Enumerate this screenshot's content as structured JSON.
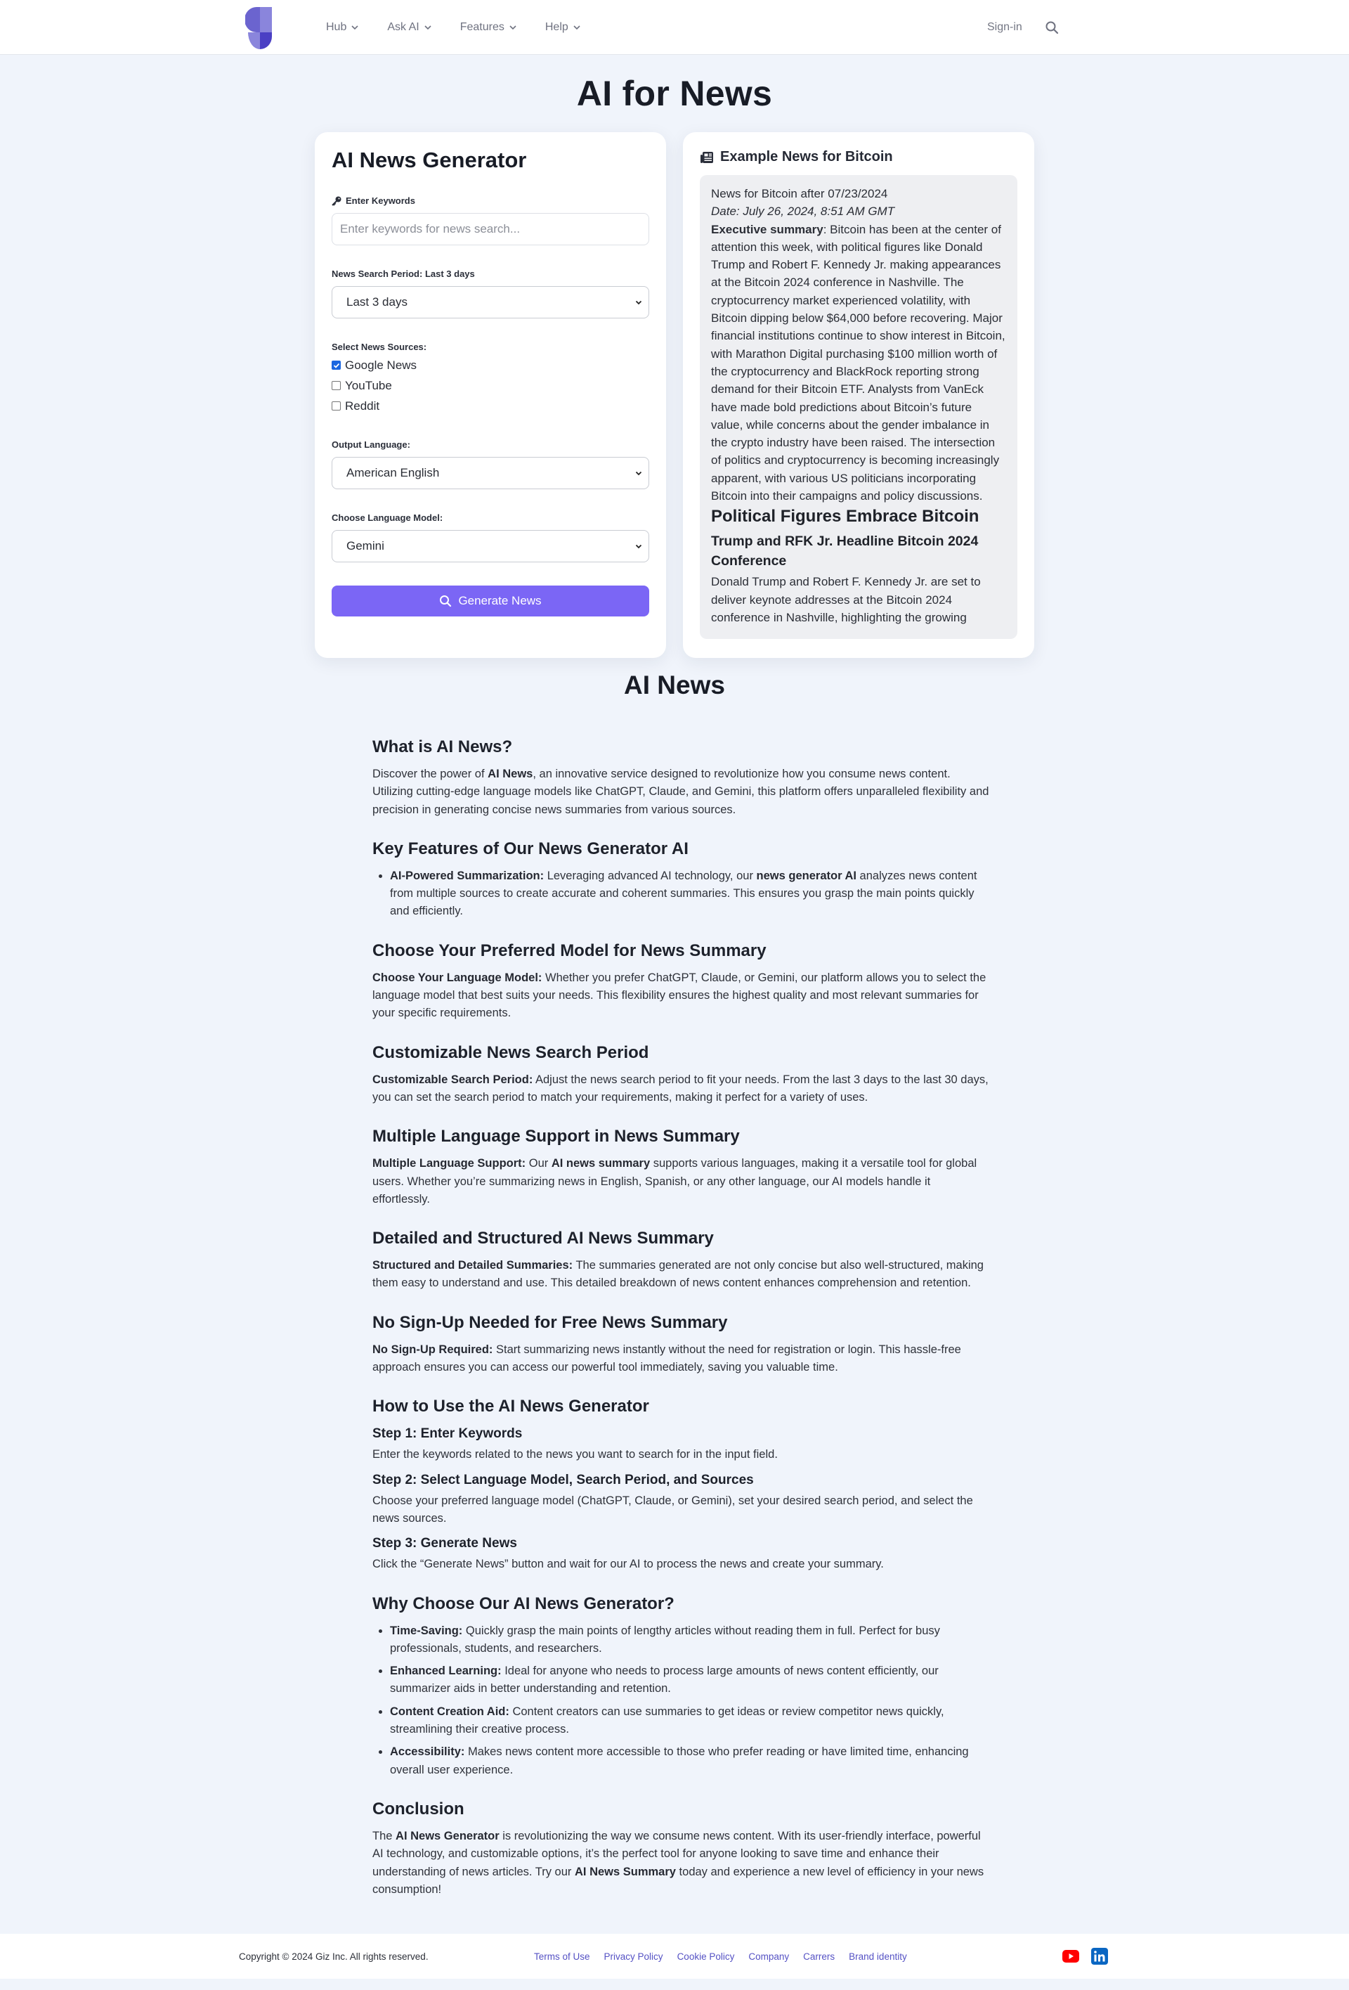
{
  "nav": {
    "logo_label": "Giz",
    "items": [
      {
        "label": "Hub"
      },
      {
        "label": "Ask AI"
      },
      {
        "label": "Features"
      },
      {
        "label": "Help"
      }
    ],
    "signin": "Sign-in",
    "search_icon": "search-icon"
  },
  "page_title": "AI for News",
  "generator": {
    "title": "AI News Generator",
    "keywords_label": "Enter Keywords",
    "keywords_value": "",
    "keywords_placeholder": "Enter keywords for news search...",
    "period_label": "News Search Period: Last 3 days",
    "period_value": "Last 3 days",
    "sources_label": "Select News Sources:",
    "sources": [
      {
        "label": "Google News",
        "checked": true
      },
      {
        "label": "YouTube",
        "checked": false
      },
      {
        "label": "Reddit",
        "checked": false
      }
    ],
    "language_label": "Output Language:",
    "language_value": "American English",
    "model_label": "Choose Language Model:",
    "model_value": "Gemini",
    "generate_label": "Generate News",
    "accent_color": "#7b66f5"
  },
  "example": {
    "title": "Example News for Bitcoin",
    "heading_line": "News for Bitcoin after 07/23/2024",
    "date_line": "Date: July 26, 2024, 8:51 AM GMT",
    "summary_label": "Executive summary",
    "summary_text": ": Bitcoin has been at the center of attention this week, with political figures like Donald Trump and Robert F. Kennedy Jr. making appearances at the Bitcoin 2024 conference in Nashville. The cryptocurrency market experienced volatility, with Bitcoin dipping below $64,000 before recovering. Major financial institutions continue to show interest in Bitcoin, with Marathon Digital purchasing $100 million worth of the cryptocurrency and BlackRock reporting strong demand for their Bitcoin ETF. Analysts from VanEck have made bold predictions about Bitcoin’s future value, while concerns about the gender imbalance in the crypto industry have been raised. The intersection of politics and cryptocurrency is becoming increasingly apparent, with various US politicians incorporating Bitcoin into their campaigns and policy discussions.",
    "section_heading": "Political Figures Embrace Bitcoin",
    "sub_heading": "Trump and RFK Jr. Headline Bitcoin 2024 Conference",
    "body_text": "Donald Trump and Robert F. Kennedy Jr. are set to deliver keynote addresses at the Bitcoin 2024 conference in Nashville, highlighting the growing"
  },
  "article": {
    "title": "AI News",
    "sections": [
      {
        "heading": "What is AI News?",
        "paragraphs": [
          [
            [
              "t",
              "Discover the power of "
            ],
            [
              "b",
              "AI News"
            ],
            [
              "t",
              ", an innovative service designed to revolutionize how you consume news content. Utilizing cutting-edge language models like ChatGPT, Claude, and Gemini, this platform offers unparalleled flexibility and precision in generating concise news summaries from various sources."
            ]
          ]
        ]
      },
      {
        "heading": "Key Features of Our News Generator AI",
        "bullets": [
          [
            [
              "b",
              "AI-Powered Summarization:"
            ],
            [
              "t",
              " Leveraging advanced AI technology, our "
            ],
            [
              "b",
              "news generator AI"
            ],
            [
              "t",
              " analyzes news content from multiple sources to create accurate and coherent summaries. This ensures you grasp the main points quickly and efficiently."
            ]
          ]
        ]
      },
      {
        "heading": "Choose Your Preferred Model for News Summary",
        "paragraphs": [
          [
            [
              "b",
              "Choose Your Language Model:"
            ],
            [
              "t",
              " Whether you prefer ChatGPT, Claude, or Gemini, our platform allows you to select the language model that best suits your needs. This flexibility ensures the highest quality and most relevant summaries for your specific requirements."
            ]
          ]
        ]
      },
      {
        "heading": "Customizable News Search Period",
        "paragraphs": [
          [
            [
              "b",
              "Customizable Search Period:"
            ],
            [
              "t",
              " Adjust the news search period to fit your needs. From the last 3 days to the last 30 days, you can set the search period to match your requirements, making it perfect for a variety of uses."
            ]
          ]
        ]
      },
      {
        "heading": "Multiple Language Support in News Summary",
        "paragraphs": [
          [
            [
              "b",
              "Multiple Language Support:"
            ],
            [
              "t",
              " Our "
            ],
            [
              "b",
              "AI news summary"
            ],
            [
              "t",
              " supports various languages, making it a versatile tool for global users. Whether you’re summarizing news in English, Spanish, or any other language, our AI models handle it effortlessly."
            ]
          ]
        ]
      },
      {
        "heading": "Detailed and Structured AI News Summary",
        "paragraphs": [
          [
            [
              "b",
              "Structured and Detailed Summaries:"
            ],
            [
              "t",
              " The summaries generated are not only concise but also well-structured, making them easy to understand and use. This detailed breakdown of news content enhances comprehension and retention."
            ]
          ]
        ]
      },
      {
        "heading": "No Sign-Up Needed for Free News Summary",
        "paragraphs": [
          [
            [
              "b",
              "No Sign-Up Required:"
            ],
            [
              "t",
              " Start summarizing news instantly without the need for registration or login. This hassle-free approach ensures you can access our powerful tool immediately, saving you valuable time."
            ]
          ]
        ]
      },
      {
        "heading": "How to Use the AI News Generator",
        "steps": [
          {
            "title": "Step 1: Enter Keywords",
            "text": "Enter the keywords related to the news you want to search for in the input field."
          },
          {
            "title": "Step 2: Select Language Model, Search Period, and Sources",
            "text": "Choose your preferred language model (ChatGPT, Claude, or Gemini), set your desired search period, and select the news sources."
          },
          {
            "title": "Step 3: Generate News",
            "text": "Click the “Generate News” button and wait for our AI to process the news and create your summary."
          }
        ]
      },
      {
        "heading": "Why Choose Our AI News Generator?",
        "bullets": [
          [
            [
              "b",
              "Time-Saving:"
            ],
            [
              "t",
              " Quickly grasp the main points of lengthy articles without reading them in full. Perfect for busy professionals, students, and researchers."
            ]
          ],
          [
            [
              "b",
              "Enhanced Learning:"
            ],
            [
              "t",
              " Ideal for anyone who needs to process large amounts of news content efficiently, our summarizer aids in better understanding and retention."
            ]
          ],
          [
            [
              "b",
              "Content Creation Aid:"
            ],
            [
              "t",
              " Content creators can use summaries to get ideas or review competitor news quickly, streamlining their creative process."
            ]
          ],
          [
            [
              "b",
              "Accessibility:"
            ],
            [
              "t",
              " Makes news content more accessible to those who prefer reading or have limited time, enhancing overall user experience."
            ]
          ]
        ]
      },
      {
        "heading": "Conclusion",
        "paragraphs": [
          [
            [
              "t",
              "The "
            ],
            [
              "b",
              "AI News Generator"
            ],
            [
              "t",
              " is revolutionizing the way we consume news content. With its user-friendly interface, powerful AI technology, and customizable options, it’s the perfect tool for anyone looking to save time and enhance their understanding of news articles. Try our "
            ],
            [
              "b",
              "AI News Summary"
            ],
            [
              "t",
              " today and experience a new level of efficiency in your news consumption!"
            ]
          ]
        ]
      }
    ]
  },
  "footer": {
    "copyright": "Copyright © 2024 Giz Inc. All rights reserved.",
    "links": [
      {
        "label": "Terms of Use"
      },
      {
        "label": "Privacy Policy"
      },
      {
        "label": "Cookie Policy"
      },
      {
        "label": "Company"
      },
      {
        "label": "Carrers"
      },
      {
        "label": "Brand identity"
      }
    ],
    "socials": [
      {
        "name": "youtube",
        "color": "#ff0000"
      },
      {
        "name": "linkedin",
        "color": "#0a66c2"
      }
    ],
    "link_color": "#5552c4"
  }
}
